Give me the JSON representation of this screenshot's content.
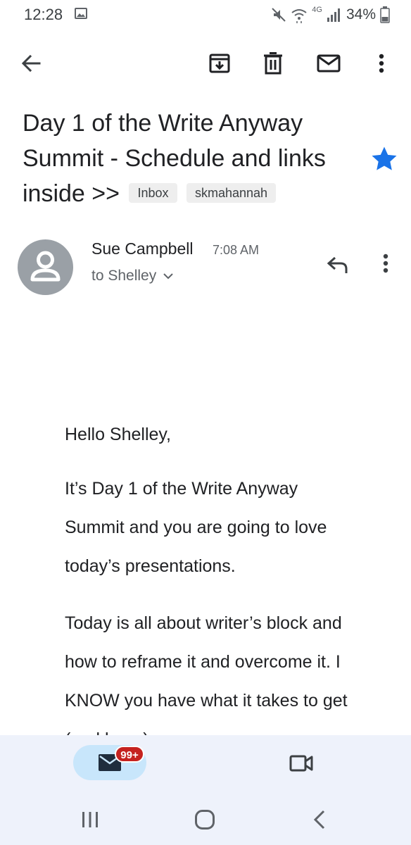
{
  "status_bar": {
    "time": "12:28",
    "network": "4G",
    "battery_text": "34%",
    "icons": [
      "image-icon",
      "mute-icon",
      "wifi-icon",
      "signal-icon",
      "battery-icon"
    ]
  },
  "toolbar": {
    "back_icon": "arrow-left-icon",
    "archive_icon": "archive-icon",
    "delete_icon": "trash-icon",
    "mark_unread_icon": "envelope-icon",
    "more_icon": "more-vert-icon"
  },
  "email": {
    "subject": "Day 1 of the Write Anyway Summit - Schedule and links inside >>",
    "labels": [
      "Inbox",
      "skmahannah"
    ],
    "starred": true,
    "sender": {
      "name": "Sue Campbell",
      "time": "7:08 AM",
      "to": "to Shelley"
    },
    "body": [
      "Hello Shelley,",
      "It’s Day 1 of the Write Anyway Summit and you are going to love today’s presentations.",
      "Today is all about writer’s block and how to reframe it and overcome it. I KNOW you have what it takes to get (and keep)"
    ]
  },
  "bottom_nav": {
    "mail_badge": "99+",
    "mail_icon": "mail-icon",
    "meet_icon": "video-camera-icon"
  },
  "system_nav": {
    "recents_icon": "recents-icon",
    "home_icon": "home-icon",
    "back_icon": "back-chevron-icon"
  },
  "colors": {
    "star": "#1a73e8",
    "badge": "#c5221f",
    "mail_pill": "#c8e6fb",
    "nav_bg": "#eef2fb",
    "avatar": "#9aa0a6"
  }
}
